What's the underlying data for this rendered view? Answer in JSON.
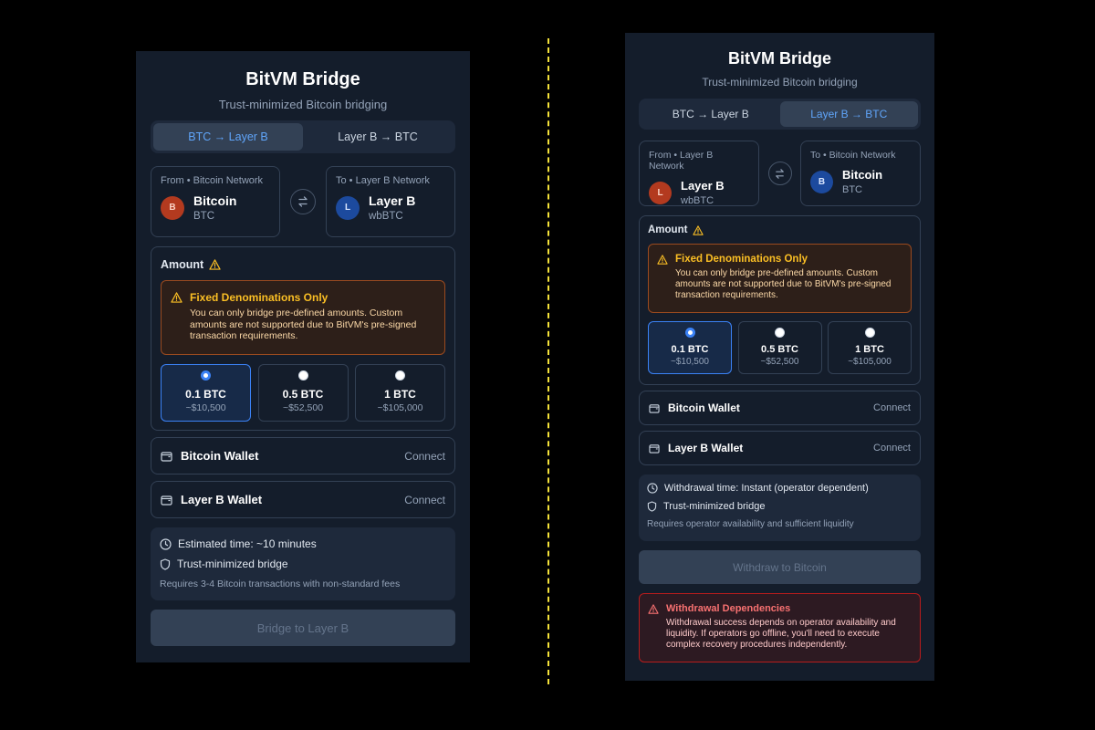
{
  "left": {
    "title": "BitVM Bridge",
    "subtitle": "Trust-minimized Bitcoin bridging",
    "tabs": [
      "BTC → Layer B",
      "Layer B → BTC"
    ],
    "active_tab": 0,
    "from": {
      "caption": "From • Bitcoin Network",
      "badge": "B",
      "name": "Bitcoin",
      "symbol": "BTC"
    },
    "to": {
      "caption": "To • Layer B Network",
      "badge": "L",
      "name": "Layer B",
      "symbol": "wbBTC"
    },
    "amount_label": "Amount",
    "warning": {
      "title": "Fixed Denominations Only",
      "text": "You can only bridge pre-defined amounts. Custom amounts are not supported due to BitVM's pre-signed transaction requirements."
    },
    "denominations": [
      {
        "value": "0.1 BTC",
        "usd": "~$10,500",
        "selected": true
      },
      {
        "value": "0.5 BTC",
        "usd": "~$52,500",
        "selected": false
      },
      {
        "value": "1 BTC",
        "usd": "~$105,000",
        "selected": false
      }
    ],
    "wallets": [
      {
        "name": "Bitcoin Wallet",
        "action": "Connect"
      },
      {
        "name": "Layer B Wallet",
        "action": "Connect"
      }
    ],
    "info": {
      "time": "Estimated time: ~10 minutes",
      "security": "Trust-minimized bridge",
      "note": "Requires 3-4 Bitcoin transactions with non-standard fees"
    },
    "action_label": "Bridge to Layer B"
  },
  "right": {
    "title": "BitVM Bridge",
    "subtitle": "Trust-minimized Bitcoin bridging",
    "tabs": [
      "BTC → Layer B",
      "Layer B → BTC"
    ],
    "active_tab": 1,
    "from": {
      "caption": "From • Layer B Network",
      "badge": "L",
      "name": "Layer B",
      "symbol": "wbBTC"
    },
    "to": {
      "caption": "To • Bitcoin Network",
      "badge": "B",
      "name": "Bitcoin",
      "symbol": "BTC"
    },
    "amount_label": "Amount",
    "warning": {
      "title": "Fixed Denominations Only",
      "text": "You can only bridge pre-defined amounts. Custom amounts are not supported due to BitVM's pre-signed transaction requirements."
    },
    "denominations": [
      {
        "value": "0.1 BTC",
        "usd": "~$10,500",
        "selected": true
      },
      {
        "value": "0.5 BTC",
        "usd": "~$52,500",
        "selected": false
      },
      {
        "value": "1 BTC",
        "usd": "~$105,000",
        "selected": false
      }
    ],
    "wallets": [
      {
        "name": "Bitcoin Wallet",
        "action": "Connect"
      },
      {
        "name": "Layer B Wallet",
        "action": "Connect"
      }
    ],
    "info": {
      "time": "Withdrawal time: Instant (operator dependent)",
      "security": "Trust-minimized bridge",
      "note": "Requires operator availability and sufficient liquidity"
    },
    "action_label": "Withdraw to Bitcoin",
    "danger": {
      "title": "Withdrawal Dependencies",
      "text": "Withdrawal success depends on operator availability and liquidity. If operators go offline, you'll need to execute complex recovery procedures independently."
    }
  },
  "colors": {
    "panel_bg": "#141d2b",
    "accent": "#3b82f6",
    "warning": "#fbbf24",
    "danger": "#f87171",
    "divider": "#f5e33a"
  },
  "icons": [
    "swap-arrows-icon",
    "warning-triangle-icon",
    "wallet-icon",
    "clock-icon",
    "shield-icon"
  ]
}
